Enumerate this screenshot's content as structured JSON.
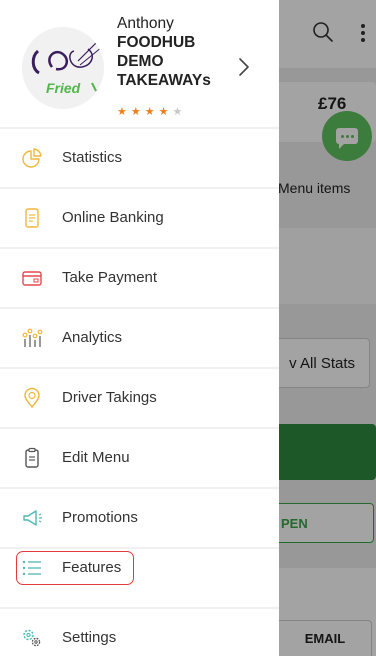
{
  "background": {
    "amount": "£76",
    "menu_items_label": "Menu items",
    "view_stats_label": "v All Stats",
    "open_label": "PEN",
    "email_label": "EMAIL"
  },
  "profile": {
    "name_line1": "Anthony",
    "name_line2": "FOODHUB DEMO TAKEAWAYs",
    "logo_text": "Fried",
    "rating": 4,
    "rating_max": 5
  },
  "menu": [
    {
      "id": "statistics",
      "label": "Statistics",
      "icon": "pie-chart-icon"
    },
    {
      "id": "online-banking",
      "label": "Online Banking",
      "icon": "document-icon"
    },
    {
      "id": "take-payment",
      "label": "Take Payment",
      "icon": "card-icon"
    },
    {
      "id": "analytics",
      "label": "Analytics",
      "icon": "analytics-icon"
    },
    {
      "id": "driver-takings",
      "label": "Driver Takings",
      "icon": "location-pin-icon"
    },
    {
      "id": "edit-menu",
      "label": "Edit Menu",
      "icon": "clipboard-icon"
    },
    {
      "id": "promotions",
      "label": "Promotions",
      "icon": "megaphone-icon"
    },
    {
      "id": "features",
      "label": "Features",
      "icon": "list-icon",
      "highlighted": true
    },
    {
      "id": "settings",
      "label": "Settings",
      "icon": "gear-icon"
    }
  ],
  "colors": {
    "accent_icon": "#f2b73a",
    "accent_icon_teal": "#4fb8b2",
    "star_on": "#ef7f1a",
    "star_off": "#c8c8c8",
    "highlight_border": "#e23b3b",
    "chat_green": "#5fc25f",
    "primary_green": "#2e8b3f"
  }
}
